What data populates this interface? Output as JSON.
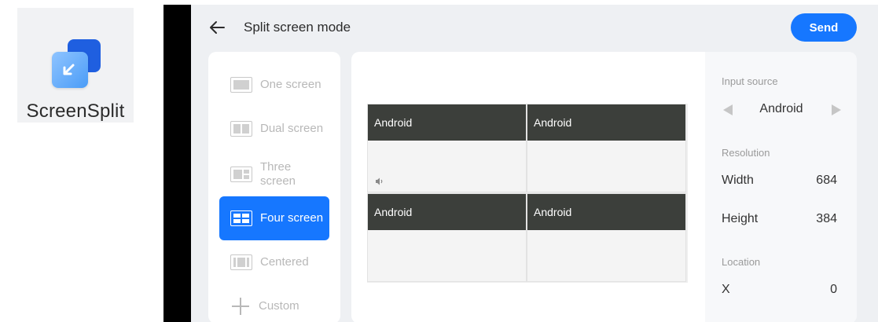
{
  "launcher": {
    "app_name": "ScreenSplit",
    "icon": "split-screen-app-icon"
  },
  "header": {
    "title": "Split screen mode",
    "send_label": "Send",
    "back_icon": "arrow-left-icon"
  },
  "modes": [
    {
      "label": "One screen"
    },
    {
      "label": "Dual screen"
    },
    {
      "label": "Three screen"
    },
    {
      "label": "Four screen",
      "selected": true
    },
    {
      "label": "Centered"
    },
    {
      "label": "Custom"
    }
  ],
  "preview": {
    "cells": [
      {
        "label": "Android",
        "audio": true
      },
      {
        "label": "Android"
      },
      {
        "label": "Android"
      },
      {
        "label": "Android"
      }
    ]
  },
  "settings": {
    "input_source_label": "Input source",
    "input_source_value": "Android",
    "resolution_label": "Resolution",
    "width_label": "Width",
    "width_value": "684",
    "height_label": "Height",
    "height_value": "384",
    "location_label": "Location",
    "x_label": "X",
    "x_value": "0"
  },
  "colors": {
    "accent": "#1677ff",
    "cell_header": "#3c3f3b",
    "screen_bg": "#eef0f3"
  }
}
